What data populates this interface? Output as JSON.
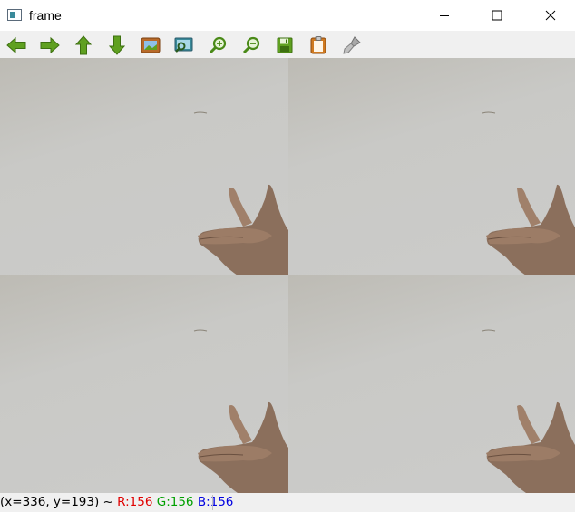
{
  "window": {
    "title": "frame",
    "icon": "app-window-icon",
    "controls": [
      "minimize-icon",
      "maximize-icon",
      "close-icon"
    ]
  },
  "toolbar": {
    "buttons": [
      {
        "name": "pan-left",
        "icon": "arrow-left-icon"
      },
      {
        "name": "pan-right",
        "icon": "arrow-right-icon"
      },
      {
        "name": "pan-up",
        "icon": "arrow-up-icon"
      },
      {
        "name": "pan-down",
        "icon": "arrow-down-icon"
      },
      {
        "name": "zoom-fit",
        "icon": "picture-icon"
      },
      {
        "name": "zoom-original",
        "icon": "picture-zoom-icon"
      },
      {
        "name": "zoom-in",
        "icon": "zoom-in-icon"
      },
      {
        "name": "zoom-out",
        "icon": "zoom-out-icon"
      },
      {
        "name": "save",
        "icon": "save-icon"
      },
      {
        "name": "copy-clipboard",
        "icon": "clipboard-icon"
      },
      {
        "name": "properties",
        "icon": "brush-icon"
      }
    ]
  },
  "image": {
    "layout": "2x2 grid of identical camera frames showing a hand gesture against a light wall"
  },
  "status": {
    "coords": "(x=336, y=193) ~ ",
    "r": "R:156",
    "g": "G:156",
    "b": "B:156"
  },
  "colors": {
    "red": "#e00000",
    "green": "#00a000",
    "blue": "#0000e0",
    "toolbar_green": "#5fa020"
  }
}
